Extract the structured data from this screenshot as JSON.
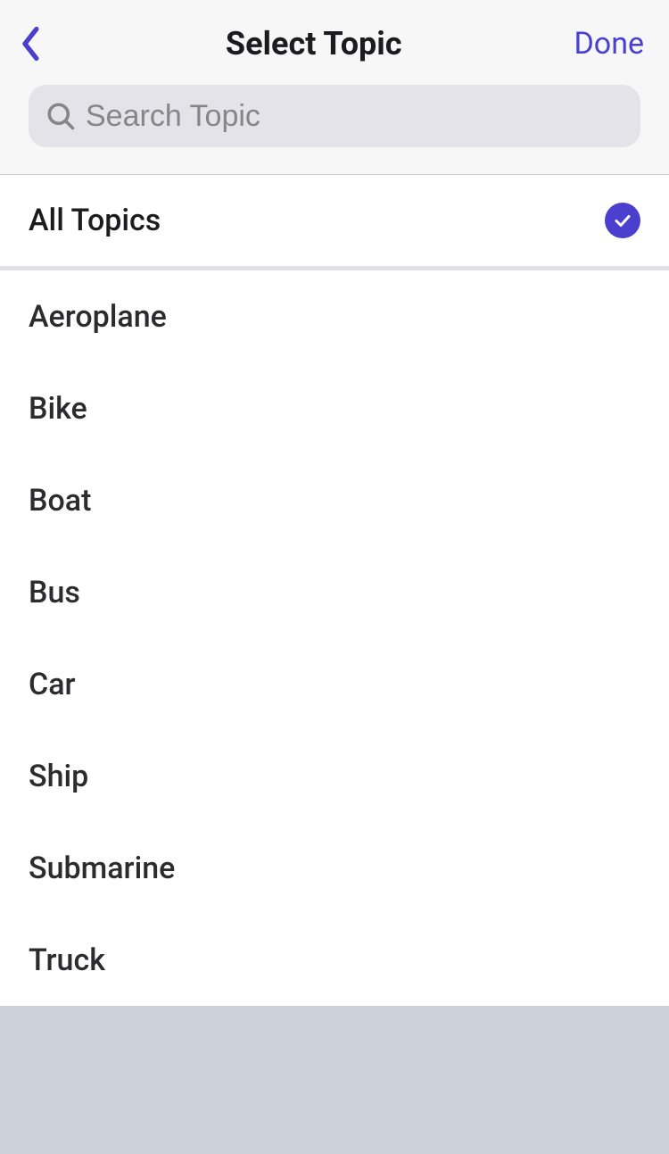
{
  "header": {
    "title": "Select Topic",
    "done_label": "Done"
  },
  "search": {
    "placeholder": "Search Topic",
    "value": ""
  },
  "all_topics": {
    "label": "All Topics",
    "selected": true
  },
  "topics": [
    {
      "label": "Aeroplane"
    },
    {
      "label": "Bike"
    },
    {
      "label": "Boat"
    },
    {
      "label": "Bus"
    },
    {
      "label": "Car"
    },
    {
      "label": "Ship"
    },
    {
      "label": "Submarine"
    },
    {
      "label": "Truck"
    }
  ]
}
